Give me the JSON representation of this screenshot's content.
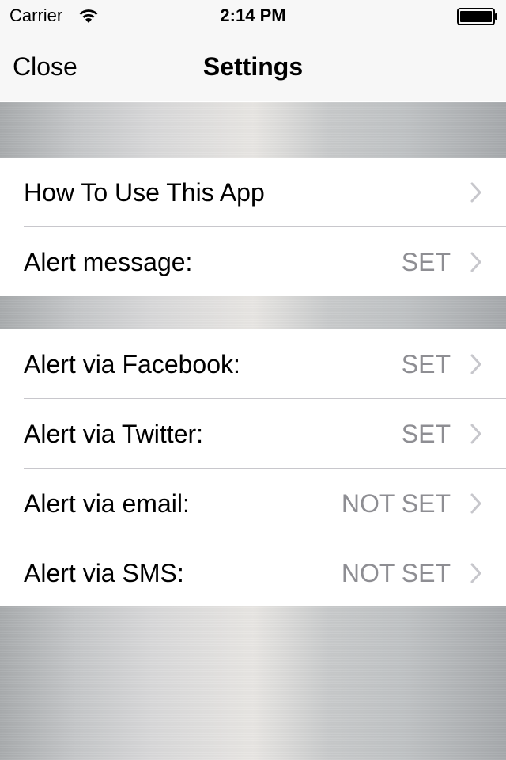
{
  "status_bar": {
    "carrier": "Carrier",
    "time": "2:14 PM",
    "icons": [
      "wifi-icon",
      "battery-icon"
    ]
  },
  "nav": {
    "close_label": "Close",
    "title": "Settings"
  },
  "groups": [
    {
      "rows": [
        {
          "label": "How To Use This App",
          "value": ""
        },
        {
          "label": "Alert message:",
          "value": "SET"
        }
      ]
    },
    {
      "rows": [
        {
          "label": "Alert via Facebook:",
          "value": "SET"
        },
        {
          "label": "Alert via Twitter:",
          "value": "SET"
        },
        {
          "label": "Alert via email:",
          "value": "NOT SET"
        },
        {
          "label": "Alert via SMS:",
          "value": "NOT SET"
        }
      ]
    }
  ],
  "colors": {
    "bar_background": "#f7f7f7",
    "value_text": "#8e8e93",
    "chevron": "#c7c7cc",
    "separator": "#c8c7cc"
  }
}
